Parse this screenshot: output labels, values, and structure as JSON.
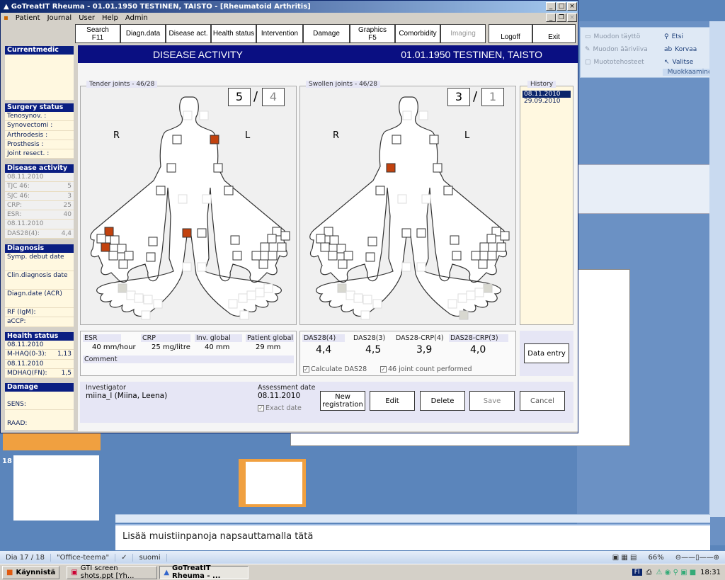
{
  "window": {
    "title": "GoTreatIT Rheuma - 01.01.1950 TESTINEN, TAISTO - [Rheumatoid Arthritis]",
    "menu": [
      "Patient",
      "Journal",
      "User",
      "Help",
      "Admin"
    ]
  },
  "nav": [
    {
      "label": "Search",
      "sub": "F11",
      "enabled": true
    },
    {
      "label": "Diagn.data",
      "sub": "",
      "enabled": true
    },
    {
      "label": "Disease act.",
      "sub": "",
      "enabled": true
    },
    {
      "label": "Health status",
      "sub": "",
      "enabled": true
    },
    {
      "label": "Intervention",
      "sub": "",
      "enabled": true
    },
    {
      "label": "Damage",
      "sub": "",
      "enabled": true
    },
    {
      "label": "Graphics",
      "sub": "F5",
      "enabled": true
    },
    {
      "label": "Comorbidity",
      "sub": "",
      "enabled": true
    },
    {
      "label": "Imaging",
      "sub": "",
      "enabled": false
    },
    {
      "label": "Logoff",
      "sub": "",
      "enabled": true
    },
    {
      "label": "Exit",
      "sub": "",
      "enabled": true
    }
  ],
  "sidebar": {
    "current_medic": {
      "title": "Currentmedic"
    },
    "surgery": {
      "title": "Surgery status",
      "rows": [
        "Tenosynov.   :",
        "Synovectomi :",
        "Arthrodesis   :",
        "Prosthesis    :",
        "Joint resect.  :"
      ]
    },
    "disease_activity": {
      "title": "Disease activity",
      "rows": [
        {
          "label": "08.11.2010",
          "value": ""
        },
        {
          "label": "TJC 46:",
          "value": "5"
        },
        {
          "label": "SJC 46:",
          "value": "3"
        },
        {
          "label": "CRP:",
          "value": "25"
        },
        {
          "label": "ESR:",
          "value": "40"
        },
        {
          "label": "08.11.2010",
          "value": ""
        },
        {
          "label": "DAS28(4):",
          "value": "4,4"
        }
      ]
    },
    "diagnosis": {
      "title": "Diagnosis",
      "rows": [
        "Symp. debut date",
        "Clin.diagnosis date",
        "Diagn.date (ACR)",
        "RF (IgM):",
        "aCCP:"
      ]
    },
    "health_status": {
      "title": "Health status",
      "rows": [
        {
          "label": "08.11.2010",
          "value": ""
        },
        {
          "label": "M-HAQ(0-3):",
          "value": "1,13"
        },
        {
          "label": "08.11.2010",
          "value": ""
        },
        {
          "label": "MDHAQ(FN):",
          "value": "1,5"
        }
      ]
    },
    "damage": {
      "title": "Damage",
      "rows": [
        "SENS:",
        "RAAD:"
      ]
    }
  },
  "header": {
    "title": "DISEASE ACTIVITY",
    "patient": "01.01.1950 TESTINEN, TAISTO"
  },
  "tender": {
    "label": "Tender joints - 46/28",
    "count46": "5",
    "count28": "4",
    "R": "R",
    "L": "L",
    "active": [
      3,
      10,
      14,
      17
    ]
  },
  "swollen": {
    "label": "Swollen joints - 46/28",
    "count46": "3",
    "count28": "1",
    "R": "R",
    "L": "L",
    "active": [
      4
    ]
  },
  "history": {
    "label": "History",
    "items": [
      "08.11.2010",
      "29.09.2010"
    ],
    "selected": 0
  },
  "labs": {
    "esr_label": "ESR",
    "esr_value": "40  mm/hour",
    "crp_label": "CRP",
    "crp_value": "25 mg/litre",
    "inv_label": "Inv. global",
    "inv_value": "40 mm",
    "pat_label": "Patient global",
    "pat_value": "29 mm",
    "comment_label": "Comment"
  },
  "das": {
    "labels": [
      "DAS28(4)",
      "DAS28(3)",
      "DAS28-CRP(4)",
      "DAS28-CRP(3)"
    ],
    "values": [
      "4,4",
      "4,5",
      "3,9",
      "4,0"
    ],
    "calc_label": "Calculate DAS28",
    "calc_checked": true,
    "joint_label": "46 joint count performed",
    "joint_checked": true
  },
  "data_entry_label": "Data entry",
  "footer": {
    "investigator_label": "Investigator",
    "investigator": "miina_l (Miina, Leena)",
    "assessment_label": "Assessment date",
    "assessment_date": "08.11.2010",
    "exact_label": "Exact date",
    "exact_checked": true,
    "buttons": [
      "New registration",
      "Edit",
      "Delete",
      "Save",
      "Cancel"
    ]
  },
  "ppt": {
    "ribbon": [
      "Muodon täyttö",
      "Muodon ääriviiva",
      "Muototehosteet"
    ],
    "edit": [
      "Etsi",
      "Korvaa",
      "Valitse"
    ],
    "group": "Muokkaaminen",
    "slide_num": "18",
    "notes": "Lisää muistiinpanoja napsauttamalla tätä",
    "status": [
      "Dia 17 / 18",
      "\"Office-teema\"",
      "suomi"
    ],
    "zoom": "66%"
  },
  "taskbar": {
    "start": "Käynnistä",
    "items": [
      "GTI screen shots.ppt [Yh...",
      "GoTreatIT Rheuma - ..."
    ],
    "lang": "FI",
    "clock": "18:31"
  }
}
